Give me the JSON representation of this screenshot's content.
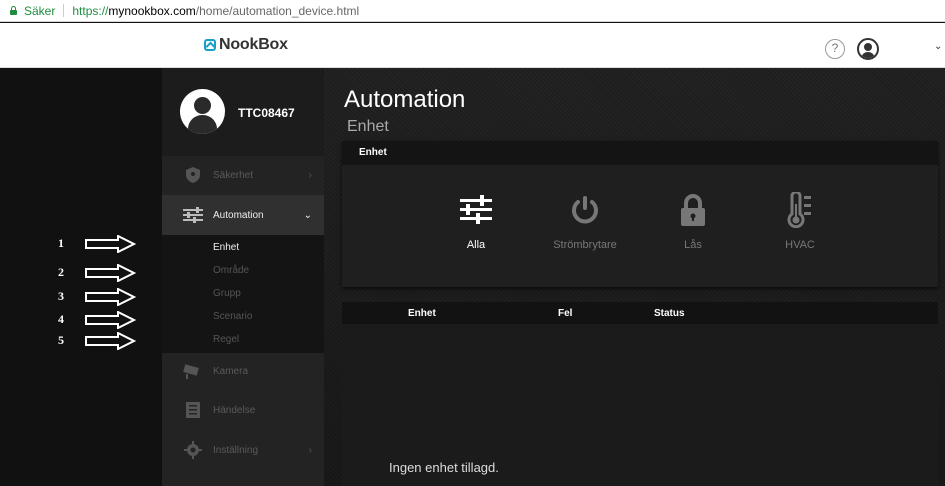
{
  "browser": {
    "secure_label": "Säker",
    "url_scheme": "https://",
    "url_host": "mynookbox.com",
    "url_path": "/home/automation_device.html"
  },
  "header": {
    "logo_text": "NookBox",
    "help_label": "?",
    "caret": "⌄"
  },
  "annotations": [
    "1",
    "2",
    "3",
    "4",
    "5"
  ],
  "sidebar": {
    "username": "TTC08467",
    "items": [
      {
        "label": "Säkerhet",
        "icon": "shield-icon",
        "chevron": "›"
      },
      {
        "label": "Automation",
        "icon": "sliders-icon",
        "chevron": "⌄"
      },
      {
        "label": "Kamera",
        "icon": "camera-icon"
      },
      {
        "label": "Händelse",
        "icon": "list-icon"
      },
      {
        "label": "Inställning",
        "icon": "gear-icon",
        "chevron": "›"
      }
    ],
    "subitems": [
      "Enhet",
      "Område",
      "Grupp",
      "Scenario",
      "Regel"
    ]
  },
  "main": {
    "title": "Automation",
    "subtitle": "Enhet",
    "panel_header": "Enhet",
    "categories": [
      {
        "label": "Alla",
        "icon": "sliders-icon"
      },
      {
        "label": "Strömbrytare",
        "icon": "power-icon"
      },
      {
        "label": "Lås",
        "icon": "lock-icon"
      },
      {
        "label": "HVAC",
        "icon": "thermometer-icon"
      }
    ],
    "table_headers": [
      "Enhet",
      "Fel",
      "Status"
    ],
    "empty_message": "Ingen enhet tillagd."
  }
}
